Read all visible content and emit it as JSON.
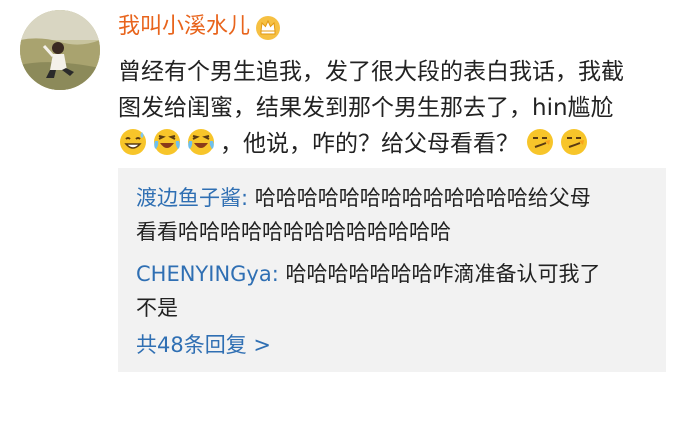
{
  "post": {
    "author": "我叫小溪水儿",
    "author_badge_icon": "crown-icon",
    "text_lines": [
      "曾经有个男生追我，发了很大段的表白我话，我截",
      "图发给闺蜜，结果发到那个男生那去了，hin尴尬"
    ],
    "emojis_leading": [
      "sweat-smile-emoji",
      "laugh-cry-emoji",
      "laugh-cry-emoji"
    ],
    "line3_text": "，他说，咋的？给父母看看？",
    "emojis_trailing": [
      "smirk-emoji",
      "smirk-emoji"
    ]
  },
  "replies": [
    {
      "author": "渡边鱼子酱:",
      "text_line1": " 哈哈哈哈哈哈哈哈哈哈哈哈哈给父母",
      "text_line2": "看看哈哈哈哈哈哈哈哈哈哈哈哈哈"
    },
    {
      "author": "CHENYINGya:",
      "text_line1": " 哈哈哈哈哈哈哈咋滴准备认可我了",
      "text_line2": "不是"
    }
  ],
  "more_replies_label": "共48条回复 >",
  "colors": {
    "username": "#e8641c",
    "link": "#2f6fb3",
    "reply_background": "#f2f2f2",
    "text": "#222222"
  }
}
